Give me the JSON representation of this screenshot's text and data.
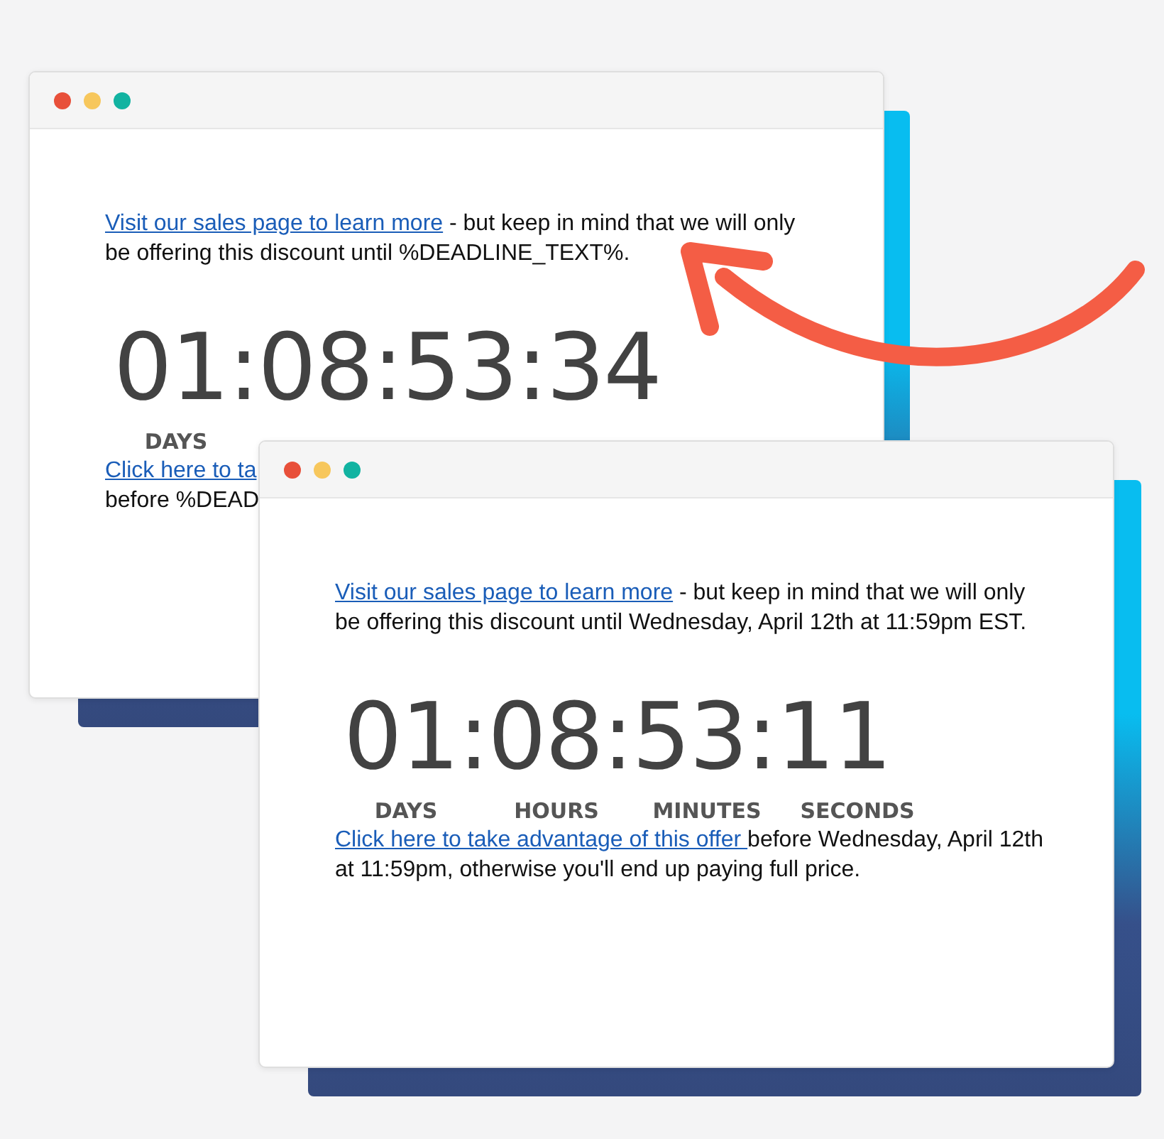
{
  "windows": [
    {
      "dots": [
        {
          "color": "#e8503a"
        },
        {
          "color": "#f7c75c"
        },
        {
          "color": "#12b3a1"
        }
      ],
      "intro": {
        "link": "Visit our sales page to learn more",
        "text": " - but keep in mind that we will only be offering this discount until %DEADLINE_TEXT%."
      },
      "countdown": {
        "value": "01:08:53:34",
        "labels": [
          "DAYS"
        ]
      },
      "cta": {
        "link": "Click here to ta",
        "text": "before %DEAD"
      }
    },
    {
      "dots": [
        {
          "color": "#e8503a"
        },
        {
          "color": "#f7c75c"
        },
        {
          "color": "#12b3a1"
        }
      ],
      "intro": {
        "link": "Visit our sales page to learn more",
        "text": " - but keep in mind that we will only be offering this discount until Wednesday, April 12th at 11:59pm EST."
      },
      "countdown": {
        "value": "01:08:53:11",
        "labels": [
          "DAYS",
          "HOURS",
          "MINUTES",
          "SECONDS"
        ]
      },
      "cta": {
        "link": "Click here to take advantage of this offer ",
        "text": "before Wednesday, April 12th at 11:59pm, otherwise you'll end up paying full price."
      }
    }
  ]
}
